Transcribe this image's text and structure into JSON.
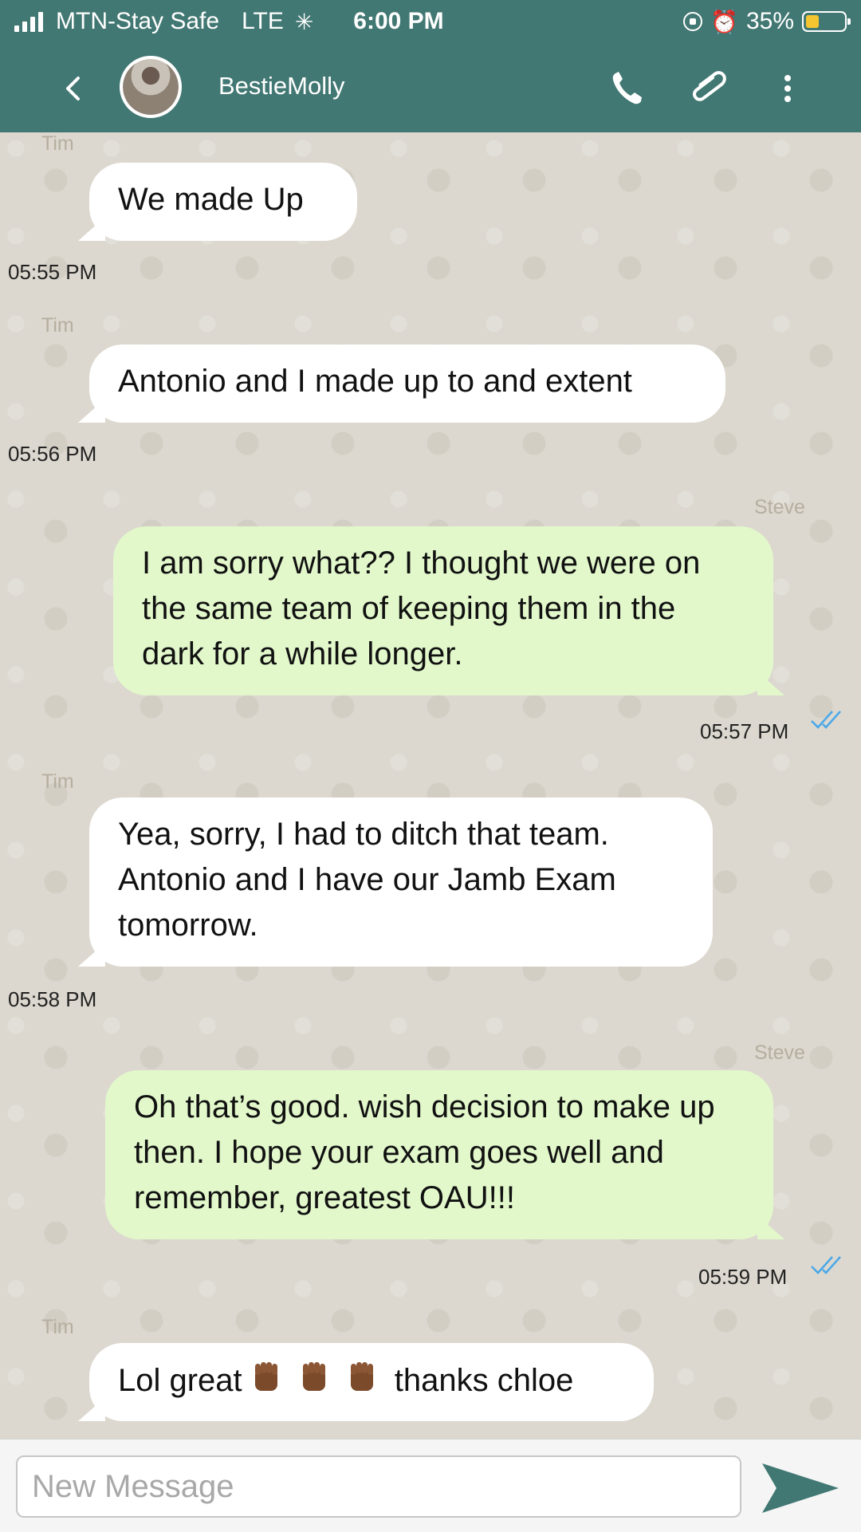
{
  "status_bar": {
    "carrier": "MTN-Stay Safe",
    "network": "LTE",
    "time": "6:00 PM",
    "battery": "35%",
    "battery_level": 0.35
  },
  "header": {
    "contact_name": "BestieMolly"
  },
  "messages": [
    {
      "sender": "Tim",
      "text": "We made Up",
      "time": "05:55 PM",
      "direction": "in"
    },
    {
      "sender": "Tim",
      "text": "Antonio and I made up to and extent",
      "time": "05:56 PM",
      "direction": "in"
    },
    {
      "sender": "Steve",
      "text": "I am sorry what?? I thought we were on the same team of keeping them in the dark for a while longer.",
      "time": "05:57 PM",
      "direction": "out"
    },
    {
      "sender": "Tim",
      "text": "Yea, sorry, I had to ditch that team. Antonio and I have our Jamb Exam tomorrow.",
      "time": "05:58 PM",
      "direction": "in"
    },
    {
      "sender": "Steve",
      "text": "Oh that’s good. wish decision to make up then. I hope your exam goes well and remember, greatest OAU!!!",
      "time": "05:59 PM",
      "direction": "out"
    },
    {
      "sender": "Tim",
      "text_before": "Lol great",
      "text_after": "thanks chloe",
      "direction": "in"
    }
  ],
  "input": {
    "placeholder": "New Message"
  },
  "colors": {
    "header": "#427873",
    "outgoing_bubble": "#e2f8cb",
    "incoming_bubble": "#ffffff",
    "read_check": "#4aa8e8",
    "send_button": "#427873"
  }
}
